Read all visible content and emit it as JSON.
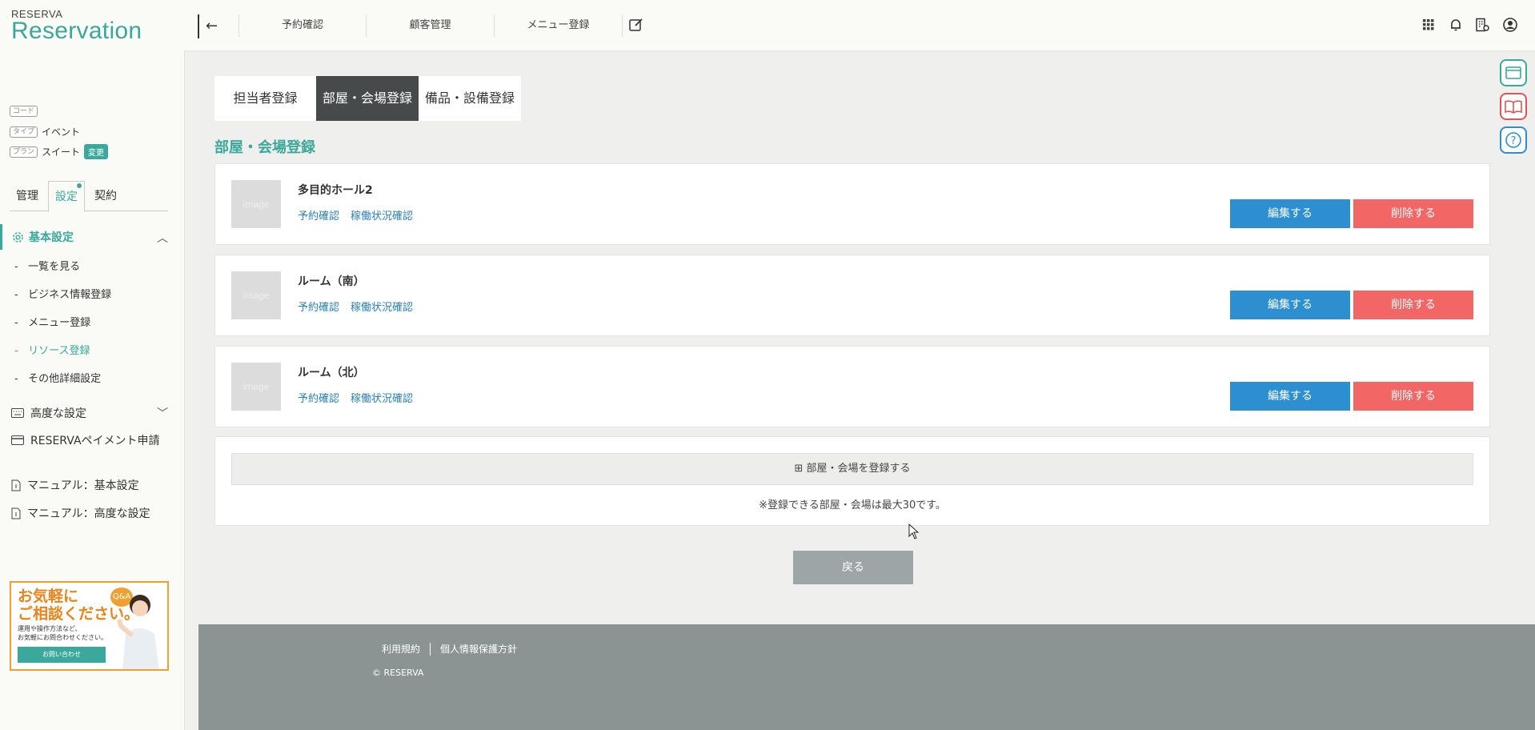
{
  "logo": {
    "small": "RESERVA",
    "big": "Reservation"
  },
  "sidebar": {
    "meta": [
      {
        "tag": "コード",
        "value": ""
      },
      {
        "tag": "タイプ",
        "value": "イベント"
      },
      {
        "tag": "プラン",
        "value": "スイート",
        "badge": "変更"
      }
    ],
    "tabs": [
      "管理",
      "設定",
      "契約"
    ],
    "section": "基本設定",
    "items": [
      "一覧を見る",
      "ビジネス情報登録",
      "メニュー登録",
      "リソース登録",
      "その他詳細設定"
    ],
    "advanced": "高度な設定",
    "payment": "RESERVAペイメント申請",
    "manual_basic": "マニュアル：基本設定",
    "manual_advanced": "マニュアル：高度な設定",
    "promo": {
      "title": "お気軽に\nご相談ください。",
      "desc": "運用や操作方法など、\nお気軽にお問合わせください。",
      "button": "お問い合わせ",
      "qa": "Q&A"
    }
  },
  "header": {
    "nav": [
      "予約確認",
      "顧客管理",
      "メニュー登録"
    ],
    "back_icon": "arrow-left-icon"
  },
  "tabs": [
    "担当者登録",
    "部屋・会場登録",
    "備品・設備登録"
  ],
  "section_title": "部屋・会場登録",
  "resources": [
    {
      "name": "多目的ホール2",
      "link1": "予約確認",
      "link2": "稼働状況確認",
      "edit": "編集する",
      "delete": "削除する",
      "image": "image"
    },
    {
      "name": "ルーム（南）",
      "link1": "予約確認",
      "link2": "稼働状況確認",
      "edit": "編集する",
      "delete": "削除する",
      "image": "image"
    },
    {
      "name": "ルーム（北）",
      "link1": "予約確認",
      "link2": "稼働状況確認",
      "edit": "編集する",
      "delete": "削除する",
      "image": "image"
    }
  ],
  "add": {
    "button": "⊞ 部屋・会場を登録する",
    "note": "※登録できる部屋・会場は最大30です。"
  },
  "back_button": "戻る",
  "footer": {
    "terms": "利用規約",
    "privacy": "個人情報保護方針",
    "copyright": "© RESERVA"
  },
  "colors": {
    "accent": "#3aa89a",
    "edit": "#2d8fcf",
    "delete": "#f26666",
    "footer": "#8c9393"
  }
}
